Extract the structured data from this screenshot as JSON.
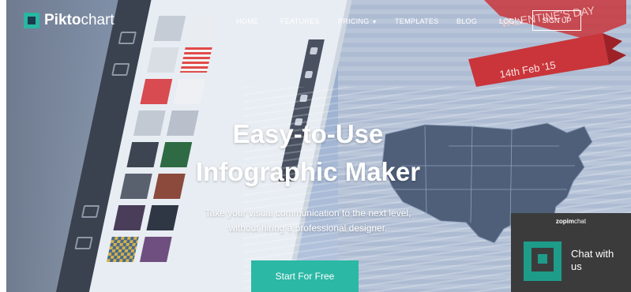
{
  "nav": {
    "logo_bold": "Pikto",
    "logo_light": "chart",
    "links": [
      {
        "label": "HOME"
      },
      {
        "label": "FEATURES"
      },
      {
        "label": "PRICING"
      },
      {
        "label": "TEMPLATES"
      },
      {
        "label": "BLOG"
      },
      {
        "label": "LOGIN"
      }
    ],
    "signup": "SIGN UP"
  },
  "hero": {
    "headline_line1": "Easy-to-Use",
    "headline_line2": "Infographic Maker",
    "sub_line1": "Take your visual communication to the next level,",
    "sub_line2": "without hiring a professional designer.",
    "cta": "Start For Free"
  },
  "background": {
    "ribbon_title": "VALENTINE'S DAY",
    "ribbon_date": "14th Feb '15"
  },
  "chat": {
    "brand_bold": "zopim",
    "brand_light": "chat",
    "label": "Chat with us"
  },
  "colors": {
    "accent": "#2bb8a5",
    "chat_bg": "#3b3b3b",
    "ribbon": "#c9353a"
  }
}
